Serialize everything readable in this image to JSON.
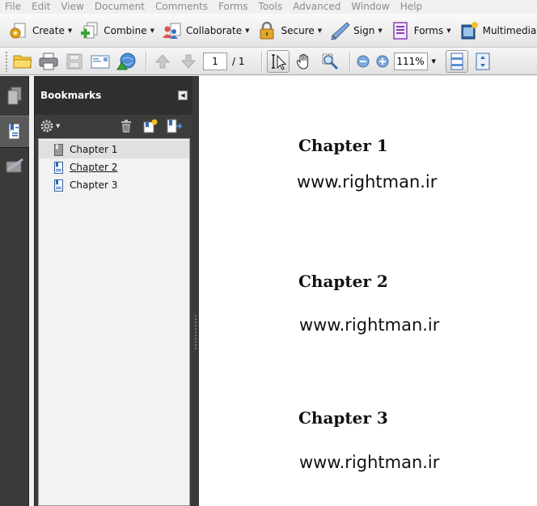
{
  "menu": [
    "File",
    "Edit",
    "View",
    "Document",
    "Comments",
    "Forms",
    "Tools",
    "Advanced",
    "Window",
    "Help"
  ],
  "tasks": [
    {
      "label": "Create",
      "icon": "create-gear-icon"
    },
    {
      "label": "Combine",
      "icon": "combine-plus-icon"
    },
    {
      "label": "Collaborate",
      "icon": "collaborate-people-icon"
    },
    {
      "label": "Secure",
      "icon": "padlock-icon"
    },
    {
      "label": "Sign",
      "icon": "pen-icon"
    },
    {
      "label": "Forms",
      "icon": "forms-icon"
    },
    {
      "label": "Multimedia",
      "icon": "film-icon"
    }
  ],
  "toolbar": {
    "page_current": "1",
    "page_total": "/ 1",
    "zoom": "111%"
  },
  "bookmarks_panel": {
    "title": "Bookmarks",
    "items": [
      {
        "label": "Chapter 1",
        "selected": true,
        "underline": false
      },
      {
        "label": "Chapter 2",
        "selected": false,
        "underline": true
      },
      {
        "label": "Chapter 3",
        "selected": false,
        "underline": false
      }
    ]
  },
  "document": {
    "sections": [
      {
        "heading": "Chapter 1",
        "text": "www.rightman.ir"
      },
      {
        "heading": "Chapter 2",
        "text": "www.rightman.ir"
      },
      {
        "heading": "Chapter 3",
        "text": "www.rightman.ir"
      }
    ]
  },
  "colors": {
    "dark_panel": "#3c3c3c",
    "menu_disabled": "#8c8c8c",
    "page_bg": "#ffffff"
  }
}
